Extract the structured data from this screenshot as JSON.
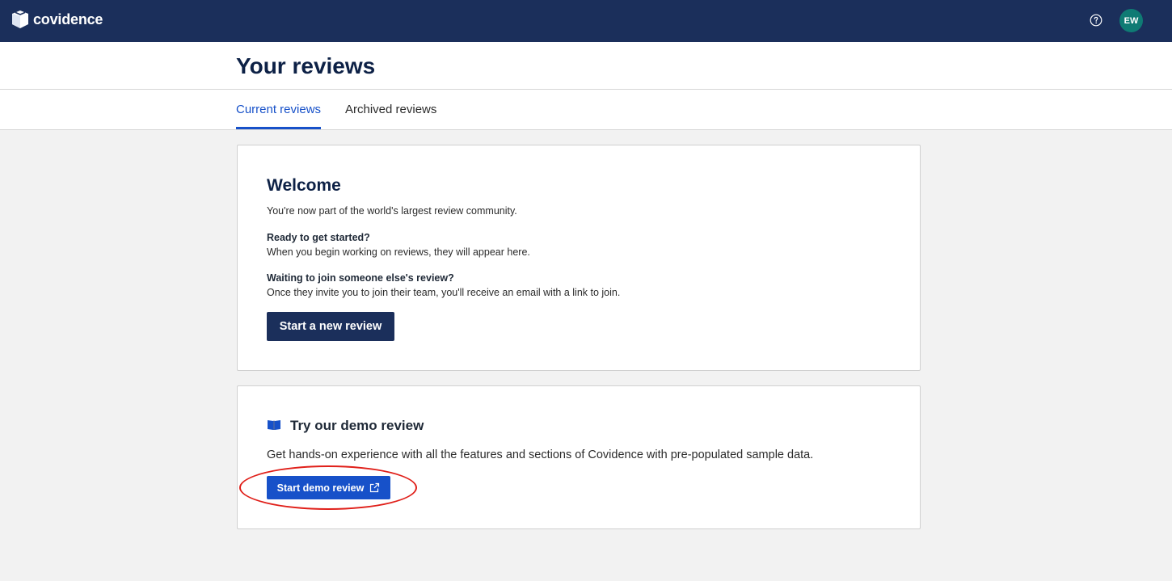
{
  "app": {
    "brand": "covidence"
  },
  "topbar": {
    "avatar_initials": "EW",
    "help_icon": "help-icon"
  },
  "header": {
    "title": "Your reviews",
    "tabs": [
      {
        "label": "Current reviews",
        "active": true
      },
      {
        "label": "Archived reviews",
        "active": false
      }
    ]
  },
  "welcome": {
    "title": "Welcome",
    "intro": "You're now part of the world's largest review community.",
    "ready_heading": "Ready to get started?",
    "ready_text": "When you begin working on reviews, they will appear here.",
    "waiting_heading": "Waiting to join someone else's review?",
    "waiting_text": "Once they invite you to join their team, you'll receive an email with a link to join.",
    "button_label": "Start a new review"
  },
  "demo": {
    "icon": "book-icon",
    "title": "Try our demo review",
    "description": "Get hands-on experience with all the features and sections of Covidence with pre-populated sample data.",
    "button_label": "Start demo review",
    "button_icon": "external-link-icon"
  },
  "colors": {
    "topbar": "#1b2f5b",
    "accent": "#1751c9",
    "avatar": "#0f7b74",
    "annotation": "#e0201a"
  }
}
